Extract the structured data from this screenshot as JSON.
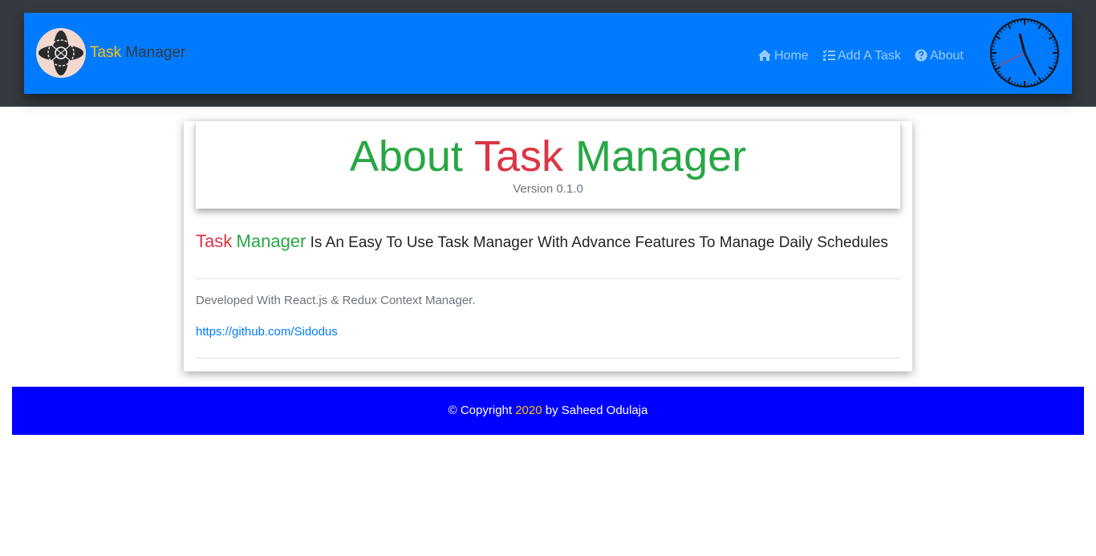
{
  "navbar": {
    "brand_word1": "Task",
    "brand_word2": "Manager",
    "logo_icon": "atom-logo-icon",
    "links": [
      {
        "label": "Home",
        "icon": "home-icon"
      },
      {
        "label": "Add A Task",
        "icon": "tasks-list-icon"
      },
      {
        "label": "About",
        "icon": "question-circle-icon"
      }
    ],
    "clock_icon": "analog-clock-icon"
  },
  "about": {
    "title_word1": "About",
    "title_word2": "Task",
    "title_word3": "Manager",
    "version": "Version 0.1.0",
    "lead_word1": "Task",
    "lead_word2": "Manager",
    "lead_text": "Is An Easy To Use Task Manager With Advance Features To Manage Daily Schedules",
    "developed": "Developed With React.js & Redux Context Manager.",
    "github_link": "https://github.com/Sidodus"
  },
  "footer": {
    "prefix": "© Copyright",
    "year": "2020",
    "suffix": "by Saheed Odulaja"
  },
  "colors": {
    "top_band": "#343a40",
    "navbar": "#007bff",
    "brand_accent": "#ffc107",
    "green": "#28a745",
    "red": "#dc3545",
    "footer": "#0000ff"
  }
}
